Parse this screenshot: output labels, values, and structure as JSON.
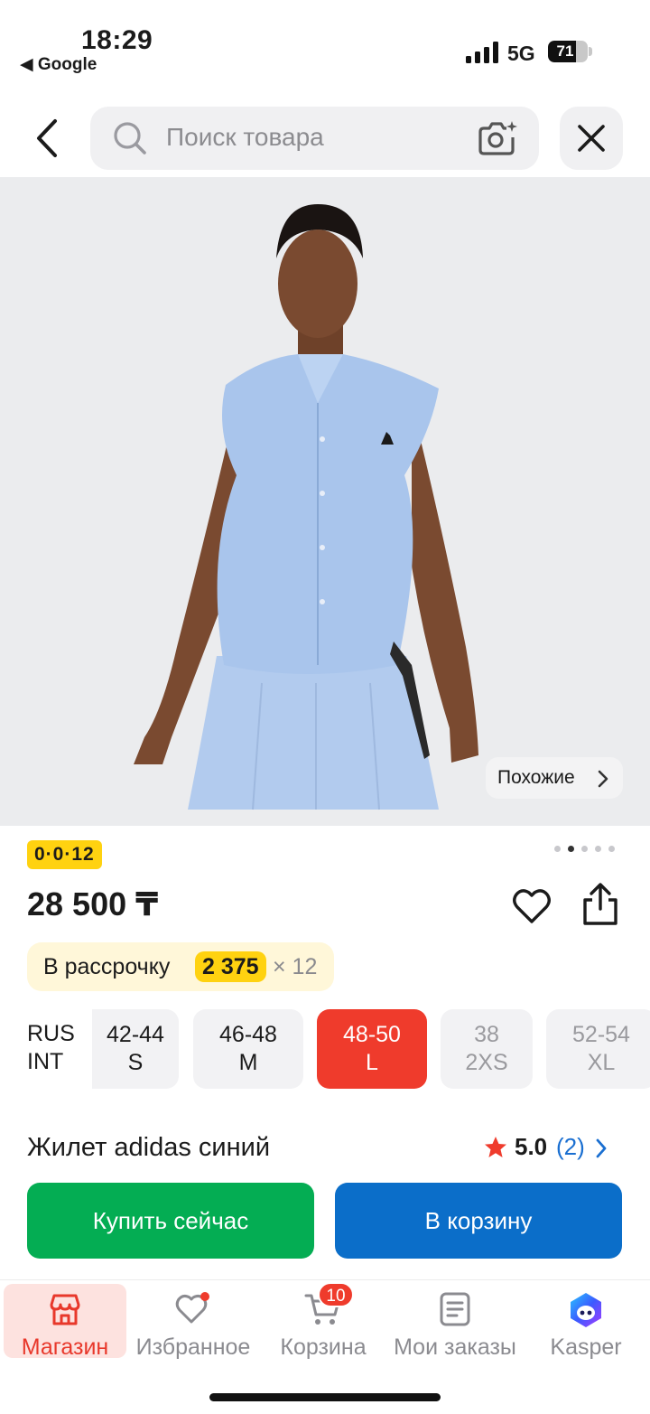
{
  "status_bar": {
    "time": "18:29",
    "back_app": "◀ Google",
    "network": "5G",
    "battery": "71",
    "battery_level": 0.71
  },
  "search": {
    "placeholder": "Поиск товара"
  },
  "icons": [
    "back-arrow-icon",
    "search-icon",
    "camera-icon",
    "close-icon",
    "chevron-right-icon",
    "heart-icon",
    "share-icon",
    "star-icon",
    "store-icon",
    "favorites-icon",
    "cart-icon",
    "orders-icon",
    "kasper-icon"
  ],
  "gallery": {
    "similar_label": "Похожие",
    "dots_total": 5,
    "dots_active": 1
  },
  "product": {
    "badge": "0·0·12",
    "price": "28 500 ₸",
    "installment": {
      "label": "В рассрочку",
      "amount": "2 375",
      "multiplier": "× 12"
    },
    "title": "Жилет adidas синий",
    "rating": {
      "value": "5.0",
      "count": "(2)"
    }
  },
  "sizes": {
    "systems": [
      "RUS",
      "INT"
    ],
    "options": [
      {
        "rus": "42-44",
        "int": "S",
        "state": "available"
      },
      {
        "rus": "46-48",
        "int": "M",
        "state": "available"
      },
      {
        "rus": "48-50",
        "int": "L",
        "state": "selected"
      },
      {
        "rus": "38",
        "int": "2XS",
        "state": "unavailable"
      },
      {
        "rus": "52-54",
        "int": "XL",
        "state": "unavailable"
      }
    ]
  },
  "actions": {
    "buy_now": "Купить сейчас",
    "add_to_cart": "В корзину"
  },
  "tabbar": {
    "tabs": [
      {
        "label": "Магазин",
        "active": true
      },
      {
        "label": "Избранное"
      },
      {
        "label": "Корзина",
        "badge": "10"
      },
      {
        "label": "Мои заказы"
      },
      {
        "label": "Kasper"
      }
    ]
  },
  "colors": {
    "accent_red": "#ef3b2c",
    "buy_green": "#04ad53",
    "cart_blue": "#0b6ec9",
    "badge_yellow": "#ffd210"
  }
}
